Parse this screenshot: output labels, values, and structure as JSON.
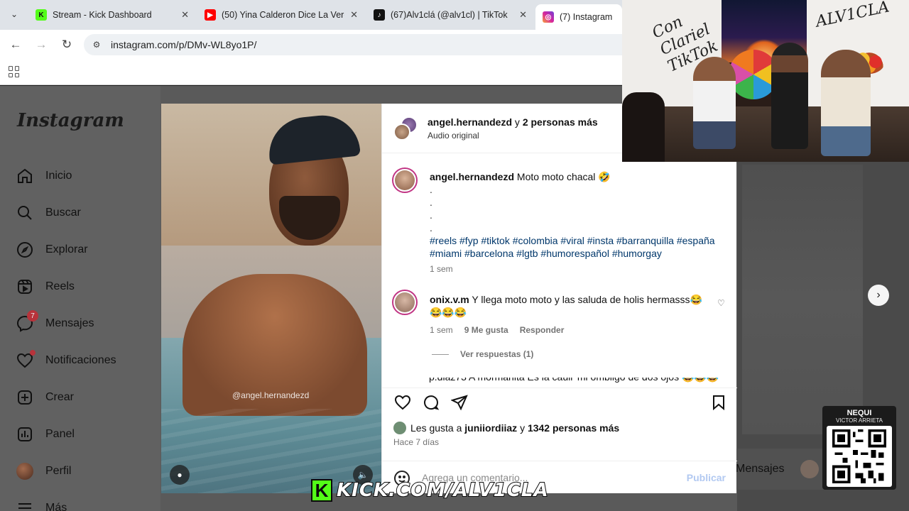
{
  "browser": {
    "tabs": [
      {
        "title": "Stream - Kick Dashboard",
        "favicon_color": "#53fc18",
        "favicon_glyph": "K"
      },
      {
        "title": "(50) Yina Calderon Dice La Verd",
        "favicon_color": "#ff0000",
        "favicon_glyph": "▶"
      },
      {
        "title": "(67)Alv1clá (@alv1cl) | TikTok",
        "favicon_color": "#111111",
        "favicon_glyph": "♪"
      },
      {
        "title": "(7) Instagram",
        "favicon_color": "#d6249f",
        "favicon_glyph": "◎"
      }
    ],
    "url": "instagram.com/p/DMv-WL8yo1P/"
  },
  "instagram": {
    "logo": "Instagram",
    "nav": [
      {
        "label": "Inicio",
        "icon": "home-icon"
      },
      {
        "label": "Buscar",
        "icon": "search-icon"
      },
      {
        "label": "Explorar",
        "icon": "compass-icon"
      },
      {
        "label": "Reels",
        "icon": "reels-icon"
      },
      {
        "label": "Mensajes",
        "icon": "messenger-icon",
        "badge": "7"
      },
      {
        "label": "Notificaciones",
        "icon": "heart-icon"
      },
      {
        "label": "Crear",
        "icon": "plus-square-icon"
      },
      {
        "label": "Panel",
        "icon": "chart-icon"
      },
      {
        "label": "Perfil",
        "icon": "avatar-icon"
      },
      {
        "label": "Más",
        "icon": "menu-icon"
      }
    ],
    "right_pill_label": "Mensajes"
  },
  "post": {
    "header_user": "angel.hernandezd",
    "header_rest": "y",
    "header_others": "2 personas más",
    "audio": "Audio original",
    "watermark": "@angel.hernandezd",
    "caption_user": "angel.hernandezd",
    "caption_text": "Moto moto chacal 🤣",
    "caption_dots": [
      ".",
      ".",
      ".",
      "."
    ],
    "hashtags": "#reels #fyp #tiktok #colombia #viral #insta #barranquilla #españa #miami #barcelona #lgtb #humorespañol #humorgay",
    "caption_time": "1 sem",
    "comment": {
      "user": "onix.v.m",
      "text": "Y llega moto moto y las saluda de holis hermasss😂😂😂😂",
      "time": "1 sem",
      "likes": "9 Me gusta",
      "reply": "Responder",
      "view_replies": "Ver respuestas (1)"
    },
    "cut_comment": "p.diaz73 A mormanita Es la cauli' mi ombligo de dos ojos 😂😂😂",
    "likes_prefix": "Les gusta a",
    "likes_user": "juniiordiiaz",
    "likes_mid": "y",
    "likes_count": "1342 personas más",
    "posted": "Hace 7 días",
    "comment_placeholder": "Agrega un comentario...",
    "publish": "Publicar"
  },
  "stream_overlay": {
    "cam_text_left": "Con Clariel TikTok",
    "cam_text_right": "ALV1CLA",
    "qr_title": "NEQUI",
    "qr_name": "VICTOR ARRIETA",
    "banner": "KICK.COM/ALV1CLA",
    "banner_logo": "K"
  }
}
